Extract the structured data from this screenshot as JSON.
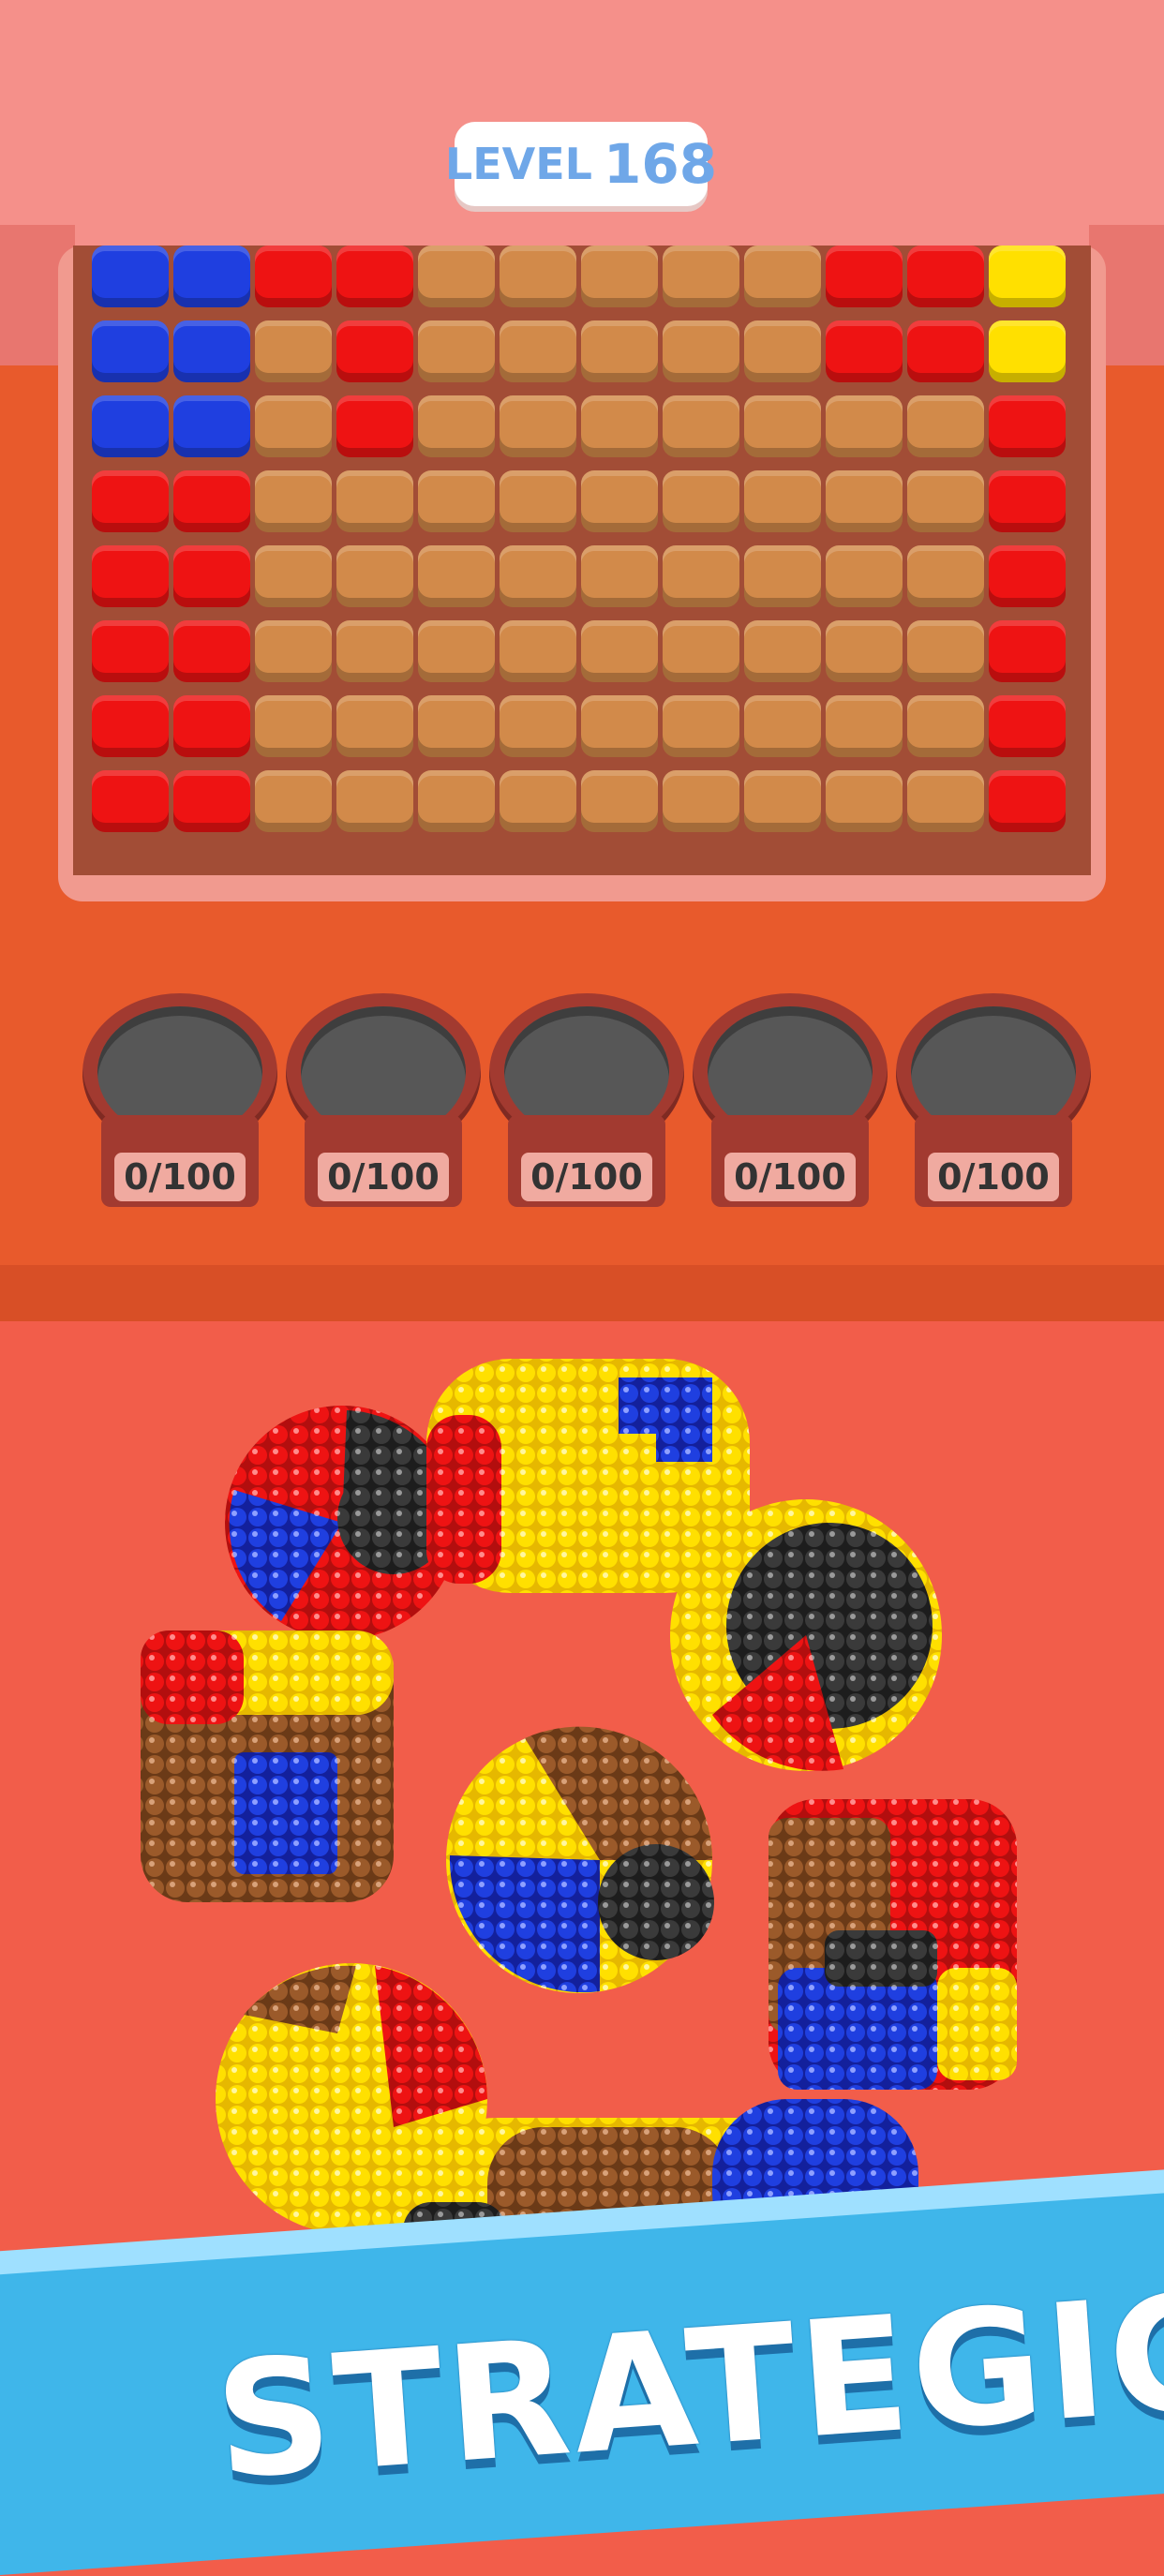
{
  "level": {
    "label": "LEVEL",
    "number": "168"
  },
  "slots": [
    {
      "count": "0/100"
    },
    {
      "count": "0/100"
    },
    {
      "count": "0/100"
    },
    {
      "count": "0/100"
    },
    {
      "count": "0/100"
    }
  ],
  "banner": {
    "text": "STRATEGIC"
  },
  "colors": {
    "blue": "#1f3fe0",
    "red": "#ee1313",
    "yellow": "#ffe000",
    "brown": "#d28a4a",
    "black": "#333333"
  },
  "grid_columns": [
    [
      "blue",
      "blue",
      "blue",
      "red",
      "red",
      "red",
      "red",
      "red"
    ],
    [
      "blue",
      "blue",
      "blue",
      "red",
      "red",
      "red",
      "red",
      "red"
    ],
    [
      "red",
      "brown",
      "brown",
      "brown",
      "brown",
      "brown",
      "brown",
      "brown"
    ],
    [
      "red",
      "red",
      "red",
      "brown",
      "brown",
      "brown",
      "brown",
      "brown"
    ],
    [
      "brown",
      "brown",
      "brown",
      "brown",
      "brown",
      "brown",
      "brown",
      "brown"
    ],
    [
      "brown",
      "brown",
      "brown",
      "brown",
      "brown",
      "brown",
      "brown",
      "brown"
    ],
    [
      "brown",
      "brown",
      "brown",
      "brown",
      "brown",
      "brown",
      "brown",
      "brown"
    ],
    [
      "brown",
      "brown",
      "brown",
      "brown",
      "brown",
      "brown",
      "brown",
      "brown"
    ],
    [
      "brown",
      "brown",
      "brown",
      "brown",
      "brown",
      "brown",
      "brown",
      "brown"
    ],
    [
      "red",
      "red",
      "brown",
      "brown",
      "brown",
      "brown",
      "brown",
      "brown"
    ],
    [
      "red",
      "red",
      "brown",
      "brown",
      "brown",
      "brown",
      "brown",
      "brown"
    ],
    [
      "yellow",
      "yellow",
      "red",
      "red",
      "red",
      "red",
      "red",
      "red"
    ]
  ]
}
